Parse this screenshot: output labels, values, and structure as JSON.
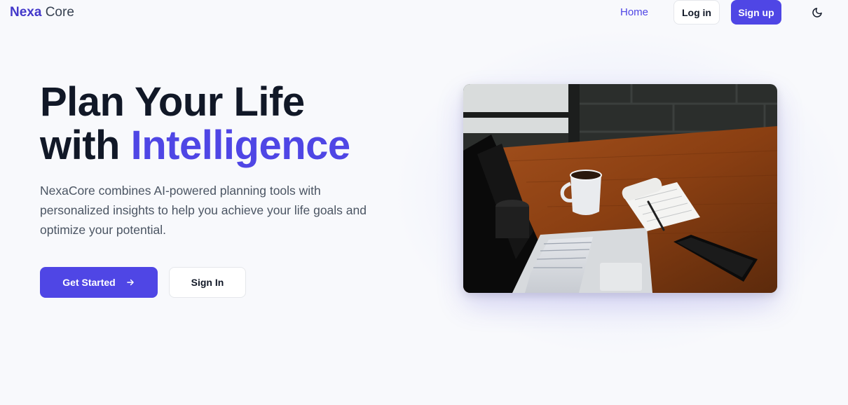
{
  "header": {
    "brand_bold": "Nexa",
    "brand_light": "Core",
    "nav_home": "Home",
    "login_label": "Log in",
    "signup_label": "Sign up",
    "theme_icon": "moon-icon"
  },
  "hero": {
    "title_line1": "Plan Your Life",
    "title_with": "with ",
    "title_accent": "Intelligence",
    "description": "NexaCore combines AI-powered planning tools with personalized insights to help you achieve your life goals and optimize your potential.",
    "primary_cta": "Get Started",
    "primary_cta_icon": "arrow-right-icon",
    "secondary_cta": "Sign In",
    "image_subject": "laptop, coffee mug, notepad, pen and phone on a wooden desk"
  },
  "colors": {
    "accent": "#4f46e5",
    "brand": "#4338ca",
    "text": "#111827",
    "muted": "#4b5563",
    "background": "#f8f9fc"
  }
}
